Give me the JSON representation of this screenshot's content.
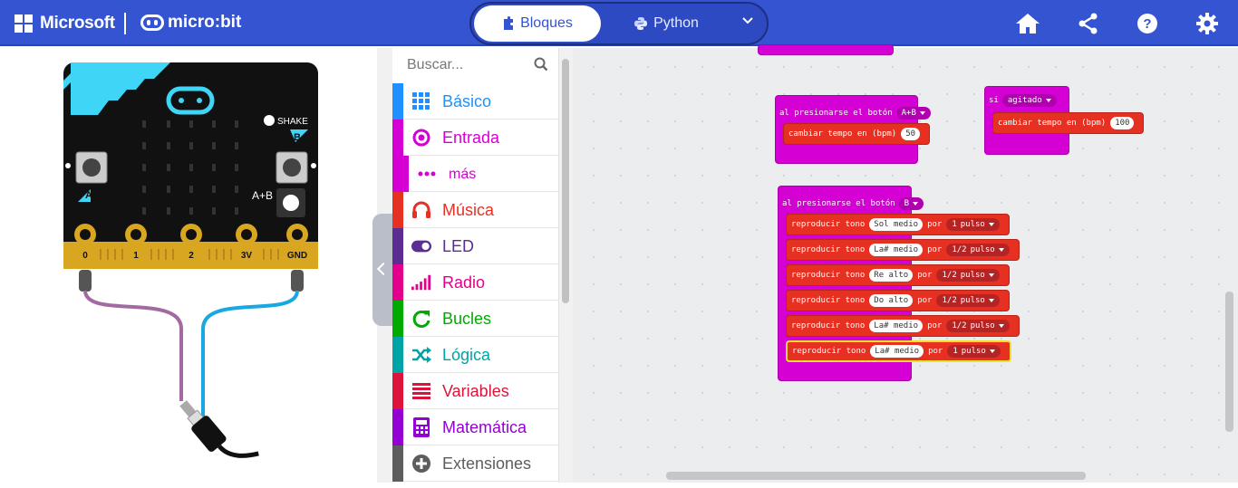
{
  "topbar": {
    "brand": "Microsoft",
    "product": "micro:bit",
    "mode_blocks": "Bloques",
    "mode_python": "Python",
    "icons": [
      "home-icon",
      "share-icon",
      "help-icon",
      "settings-icon"
    ]
  },
  "simulator": {
    "shake_label": "SHAKE",
    "button_a": "A",
    "button_b": "B",
    "button_ab": "A+B",
    "pins": [
      "0",
      "1",
      "2",
      "3V",
      "GND"
    ]
  },
  "toolbox": {
    "search_placeholder": "Buscar...",
    "categories": [
      {
        "label": "Básico",
        "color": "#1e90ff",
        "icon": "grid-icon"
      },
      {
        "label": "Entrada",
        "color": "#d400d4",
        "icon": "input-circle-icon"
      },
      {
        "label": "más",
        "color": "#d400d4",
        "icon": "dots-icon"
      },
      {
        "label": "Música",
        "color": "#e63022",
        "icon": "headphones-icon"
      },
      {
        "label": "LED",
        "color": "#5c2d91",
        "icon": "toggle-icon"
      },
      {
        "label": "Radio",
        "color": "#e3008c",
        "icon": "signal-bars-icon"
      },
      {
        "label": "Bucles",
        "color": "#00aa00",
        "icon": "loop-icon"
      },
      {
        "label": "Lógica",
        "color": "#00a4a6",
        "icon": "shuffle-icon"
      },
      {
        "label": "Variables",
        "color": "#dc143c",
        "icon": "list-lines-icon"
      },
      {
        "label": "Matemática",
        "color": "#9400d3",
        "icon": "calculator-icon"
      },
      {
        "label": "Extensiones",
        "color": "#5d5d5d",
        "icon": "plus-circle-icon"
      }
    ]
  },
  "workspace": {
    "block1": {
      "event": "al presionarse el botón",
      "button": "A+B",
      "stmt": "cambiar tempo en (bpm)",
      "value": "50"
    },
    "block2": {
      "event": "si",
      "gesture": "agitado",
      "stmt": "cambiar tempo en (bpm)",
      "value": "100"
    },
    "block3": {
      "event": "al presionarse el botón",
      "button": "B",
      "rows": [
        {
          "verb": "reproducir tono",
          "note": "Sol medio",
          "por": "por",
          "beat": "1",
          "unit": "pulso"
        },
        {
          "verb": "reproducir tono",
          "note": "La# medio",
          "por": "por",
          "beat": "1/2",
          "unit": "pulso"
        },
        {
          "verb": "reproducir tono",
          "note": "Re alto",
          "por": "por",
          "beat": "1/2",
          "unit": "pulso"
        },
        {
          "verb": "reproducir tono",
          "note": "Do alto",
          "por": "por",
          "beat": "1/2",
          "unit": "pulso"
        },
        {
          "verb": "reproducir tono",
          "note": "La# medio",
          "por": "por",
          "beat": "1/2",
          "unit": "pulso"
        },
        {
          "verb": "reproducir tono",
          "note": "La# medio",
          "por": "por",
          "beat": "1",
          "unit": "pulso"
        }
      ]
    }
  }
}
